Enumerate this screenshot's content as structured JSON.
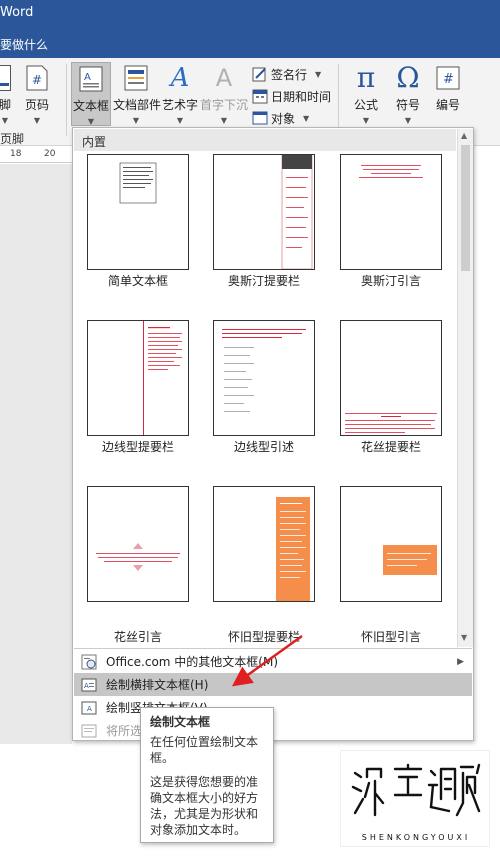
{
  "window": {
    "title_fragment": "Word",
    "tell_me": "要做什么"
  },
  "ribbon": {
    "header_footer_group_label": "页脚",
    "buttons": {
      "footer": "脚",
      "page_number": "页码",
      "text_box": "文本框",
      "doc_parts": "文档部件",
      "wordart": "艺术字",
      "drop_cap": "首字下沉",
      "signature_line": "签名行",
      "date_time": "日期和时间",
      "object": "对象",
      "equation": "公式",
      "symbol": "符号",
      "numbering": "编号"
    },
    "icons": {
      "pi": "π",
      "omega": "Ω",
      "wordart_glyph": "A",
      "dropcap_glyph": "A",
      "hash": "#"
    }
  },
  "ruler": {
    "marks": [
      "18",
      "20"
    ]
  },
  "gallery": {
    "section_label": "内置",
    "tiles": [
      {
        "label": "简单文本框"
      },
      {
        "label": "奥斯汀提要栏"
      },
      {
        "label": "奥斯汀引言"
      },
      {
        "label": "边线型提要栏"
      },
      {
        "label": "边线型引述"
      },
      {
        "label": "花丝提要栏"
      },
      {
        "label": "花丝引言"
      },
      {
        "label": "怀旧型提要栏"
      },
      {
        "label": "怀旧型引言"
      }
    ]
  },
  "menu": {
    "more_online": "Office.com 中的其他文本框(M)",
    "draw_horizontal": "绘制横排文本框(H)",
    "draw_vertical": "绘制竖排文本框(V)",
    "save_selection": "将所选"
  },
  "tooltip": {
    "title": "绘制文本框",
    "line1": "在任何位置绘制文本框。",
    "line2": "这是获得您想要的准确文本框大小的好方法，尤其是为形状和对象添加文本时。"
  },
  "watermark": {
    "subtitle": "SHENKONGYOUXI"
  },
  "colors": {
    "title_bar": "#2b579a",
    "accent_red": "#d9283a",
    "accent_orange": "#f58d4b",
    "arrow": "#e02020"
  }
}
